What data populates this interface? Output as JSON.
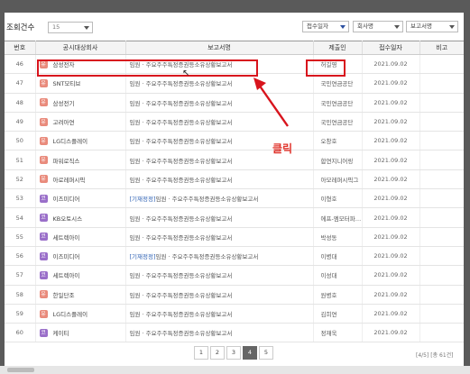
{
  "toolbar": {
    "count_label": "조회건수",
    "count_value": "15",
    "sort_date": "접수일자",
    "sort_company": "회사명",
    "sort_report": "보고서명"
  },
  "table": {
    "headers": [
      "번호",
      "공시대상회사",
      "보고서명",
      "제출인",
      "접수일자",
      "비고"
    ],
    "rows": [
      {
        "num": "46",
        "badge": "유",
        "company": "삼성전자",
        "tag": "",
        "report": "임원 · 주요주주특정증권등소유상황보고서",
        "submitter": "허길영",
        "date": "2021.09.02",
        "note": ""
      },
      {
        "num": "47",
        "badge": "유",
        "company": "SNT모티브",
        "tag": "",
        "report": "임원 · 주요주주특정증권등소유상황보고서",
        "submitter": "국민연금공단",
        "date": "2021.09.02",
        "note": ""
      },
      {
        "num": "48",
        "badge": "유",
        "company": "삼성전기",
        "tag": "",
        "report": "임원 · 주요주주특정증권등소유상황보고서",
        "submitter": "국민연금공단",
        "date": "2021.09.02",
        "note": ""
      },
      {
        "num": "49",
        "badge": "유",
        "company": "고려아연",
        "tag": "",
        "report": "임원 · 주요주주특정증권등소유상황보고서",
        "submitter": "국민연금공단",
        "date": "2021.09.02",
        "note": ""
      },
      {
        "num": "50",
        "badge": "유",
        "company": "LG디스플레이",
        "tag": "",
        "report": "임원 · 주요주주특정증권등소유상황보고서",
        "submitter": "오창호",
        "date": "2021.09.02",
        "note": ""
      },
      {
        "num": "51",
        "badge": "유",
        "company": "파워로직스",
        "tag": "",
        "report": "임원 · 주요주주특정증권등소유상황보고서",
        "submitter": "합연지니어링",
        "date": "2021.09.02",
        "note": ""
      },
      {
        "num": "52",
        "badge": "유",
        "company": "아로레퍼시픽",
        "tag": "",
        "report": "임원 · 주요주주특정증권등소유상황보고서",
        "submitter": "아모레퍼시픽그",
        "date": "2021.09.02",
        "note": ""
      },
      {
        "num": "53",
        "badge": "코",
        "company": "이즈미디어",
        "tag": "[기재정정]",
        "report": "임원 · 주요주주특정증권등소유상황보고서",
        "submitter": "이형호",
        "date": "2021.09.02",
        "note": ""
      },
      {
        "num": "54",
        "badge": "코",
        "company": "KB오토시스",
        "tag": "",
        "report": "임원 · 주요주주특정증권등소유상황보고서",
        "submitter": "에프-엠모터파…",
        "date": "2021.09.02",
        "note": ""
      },
      {
        "num": "55",
        "badge": "코",
        "company": "세트렉아이",
        "tag": "",
        "report": "임원 · 주요주주특정증권등소유상황보고서",
        "submitter": "박성동",
        "date": "2021.09.02",
        "note": ""
      },
      {
        "num": "56",
        "badge": "코",
        "company": "이즈미디어",
        "tag": "[기재정정]",
        "report": "임원 · 주요주주특정증권등소유상황보고서",
        "submitter": "이병대",
        "date": "2021.09.02",
        "note": ""
      },
      {
        "num": "57",
        "badge": "코",
        "company": "세트렉아이",
        "tag": "",
        "report": "임원 · 주요주주특정증권등소유상황보고서",
        "submitter": "이성대",
        "date": "2021.09.02",
        "note": ""
      },
      {
        "num": "58",
        "badge": "유",
        "company": "한일단조",
        "tag": "",
        "report": "임원 · 주요주주특정증권등소유상황보고서",
        "submitter": "원병호",
        "date": "2021.09.02",
        "note": ""
      },
      {
        "num": "59",
        "badge": "유",
        "company": "LG디스플레이",
        "tag": "",
        "report": "임원 · 주요주주특정증권등소유상황보고서",
        "submitter": "김희연",
        "date": "2021.09.02",
        "note": ""
      },
      {
        "num": "60",
        "badge": "코",
        "company": "케이티",
        "tag": "",
        "report": "임원 · 주요주주특정증권등소유상황보고서",
        "submitter": "정재욱",
        "date": "2021.09.02",
        "note": ""
      }
    ]
  },
  "annotation": {
    "click_label": "클릭",
    "color": "#d8141d"
  },
  "pagination": {
    "pages": [
      "1",
      "2",
      "3",
      "4",
      "5"
    ],
    "current": "4",
    "info": "[4/5] [총 61건]"
  },
  "colors": {
    "badge_yu": "#e98a7b",
    "badge_ko": "#9a6fc9",
    "tag_link": "#2b5fb3"
  },
  "icons": {
    "sort_caret": "caret-down-icon",
    "cursor": "mouse-pointer-icon",
    "arrow": "annotation-arrow-icon"
  }
}
